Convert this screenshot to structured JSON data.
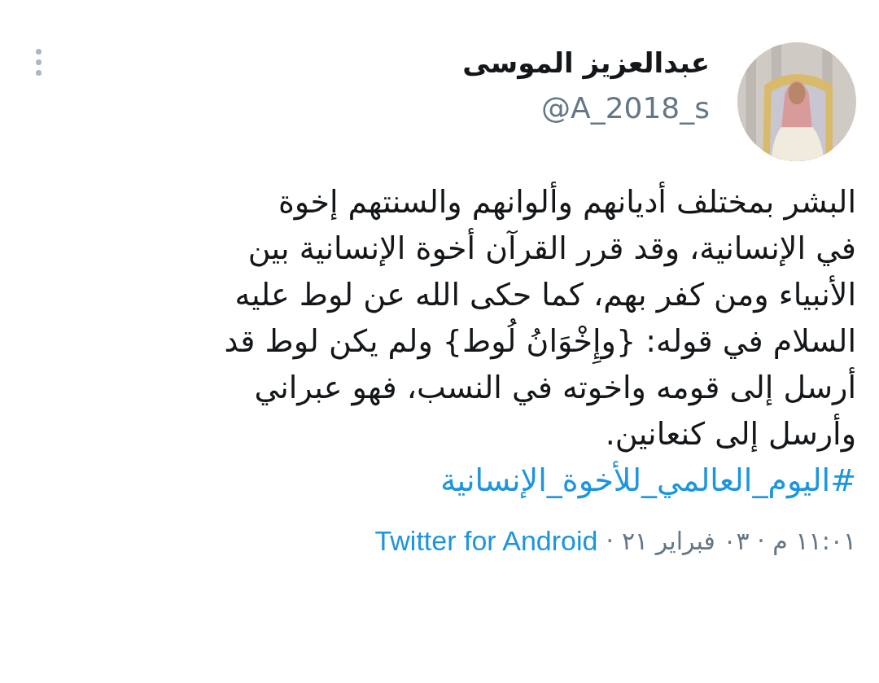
{
  "user": {
    "name": "عبدالعزيز الموسى",
    "handle": "@A_2018_s"
  },
  "tweet": {
    "text": "البشر بمختلف أديانهم وألوانهم والسنتهم إخوة\nفي الإنسانية، وقد قرر القرآن أخوة الإنسانية بين\nالأنبياء ومن كفر بهم، كما حكى الله عن لوط عليه\nالسلام في قوله: {وإِخْوَانُ لُوط} ولم يكن لوط قد\nأرسل إلى قومه واخوته في النسب، فهو عبراني\nوأرسل إلى كنعانين.",
    "hashtag": "#اليوم_العالمي_للأخوة_الإنسانية"
  },
  "meta": {
    "timestamp": "١١:٠١ م · ٠٣ فبراير ٢١",
    "separator": "·",
    "source": "Twitter for Android"
  }
}
